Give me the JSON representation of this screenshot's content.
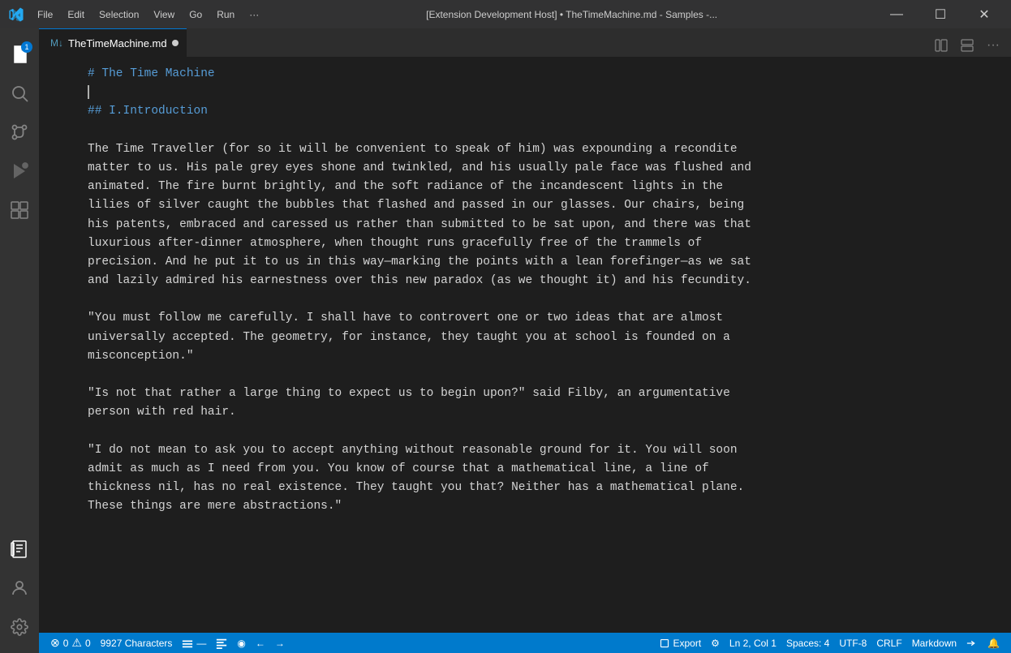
{
  "titlebar": {
    "title": "[Extension Development Host] • TheTimeMachine.md - Samples -...",
    "menu_items": [
      "File",
      "Edit",
      "Selection",
      "View",
      "Go",
      "Run",
      "···"
    ]
  },
  "tab": {
    "icon": "●",
    "filename": "TheTimeMachine.md",
    "modified_dot": "●"
  },
  "tab_actions": {
    "split_label": "⊞",
    "layout_label": "⊟",
    "more_label": "···"
  },
  "editor": {
    "lines": [
      {
        "type": "h1",
        "content": "# The Time Machine"
      },
      {
        "type": "cursor",
        "content": ""
      },
      {
        "type": "h2",
        "content": "## I.Introduction"
      },
      {
        "type": "empty",
        "content": ""
      },
      {
        "type": "normal",
        "content": "The Time Traveller (for so it will be convenient to speak of him) was expounding a recondite"
      },
      {
        "type": "normal",
        "content": "matter to us. His pale grey eyes shone and twinkled, and his usually pale face was flushed and"
      },
      {
        "type": "normal",
        "content": "animated. The fire burnt brightly, and the soft radiance of the incandescent lights in the"
      },
      {
        "type": "normal",
        "content": "lilies of silver caught the bubbles that flashed and passed in our glasses. Our chairs, being"
      },
      {
        "type": "normal",
        "content": "his patents, embraced and caressed us rather than submitted to be sat upon, and there was that"
      },
      {
        "type": "normal",
        "content": "luxurious after-dinner atmosphere, when thought runs gracefully free of the trammels of"
      },
      {
        "type": "normal",
        "content": "precision. And he put it to us in this way—marking the points with a lean forefinger—as we sat"
      },
      {
        "type": "normal",
        "content": "and lazily admired his earnestness over this new paradox (as we thought it) and his fecundity."
      },
      {
        "type": "empty",
        "content": ""
      },
      {
        "type": "normal",
        "content": "\"You must follow me carefully. I shall have to controvert one or two ideas that are almost"
      },
      {
        "type": "normal",
        "content": "universally accepted. The geometry, for instance, they taught you at school is founded on a"
      },
      {
        "type": "normal",
        "content": "misconception.\""
      },
      {
        "type": "empty",
        "content": ""
      },
      {
        "type": "normal",
        "content": "\"Is not that rather a large thing to expect us to begin upon?\" said Filby, an argumentative"
      },
      {
        "type": "normal",
        "content": "person with red hair."
      },
      {
        "type": "empty",
        "content": ""
      },
      {
        "type": "normal",
        "content": "\"I do not mean to ask you to accept anything without reasonable ground for it. You will soon"
      },
      {
        "type": "normal",
        "content": "admit as much as I need from you. You know of course that a mathematical line, a line of"
      },
      {
        "type": "normal",
        "content": "thickness nil, has no real existence. They taught you that? Neither has a mathematical plane."
      },
      {
        "type": "normal",
        "content": "These things are mere abstractions.\""
      }
    ]
  },
  "statusbar": {
    "errors": "0",
    "warnings": "0",
    "characters": "9927 Characters",
    "branch_icon": "⎇",
    "export_label": "Export",
    "settings_icon": "⚙",
    "position": "Ln 2, Col 1",
    "spaces": "Spaces: 4",
    "encoding": "UTF-8",
    "line_ending": "CRLF",
    "language": "Markdown",
    "bell_icon": "🔔",
    "sync_icon": "↺",
    "feedback_icon": "☺"
  },
  "activity": {
    "icons": [
      {
        "name": "explorer",
        "symbol": "⎗",
        "badge": "1",
        "active": true
      },
      {
        "name": "search",
        "symbol": "🔍",
        "active": false
      },
      {
        "name": "source-control",
        "symbol": "⑂",
        "active": false
      },
      {
        "name": "run-debug",
        "symbol": "▷",
        "active": false
      },
      {
        "name": "extensions",
        "symbol": "⊞",
        "active": false
      },
      {
        "name": "notebook",
        "symbol": "⊟",
        "active": true
      }
    ],
    "bottom_icons": [
      {
        "name": "account",
        "symbol": "👤"
      },
      {
        "name": "settings",
        "symbol": "⚙"
      }
    ]
  },
  "colors": {
    "accent": "#0078d4",
    "statusbar": "#007acc",
    "titlebar": "#323233",
    "activitybar": "#333333",
    "editor_bg": "#1e1e1e",
    "h1_color": "#569cd6",
    "h2_color": "#569cd6",
    "text_color": "#d4d4d4"
  }
}
